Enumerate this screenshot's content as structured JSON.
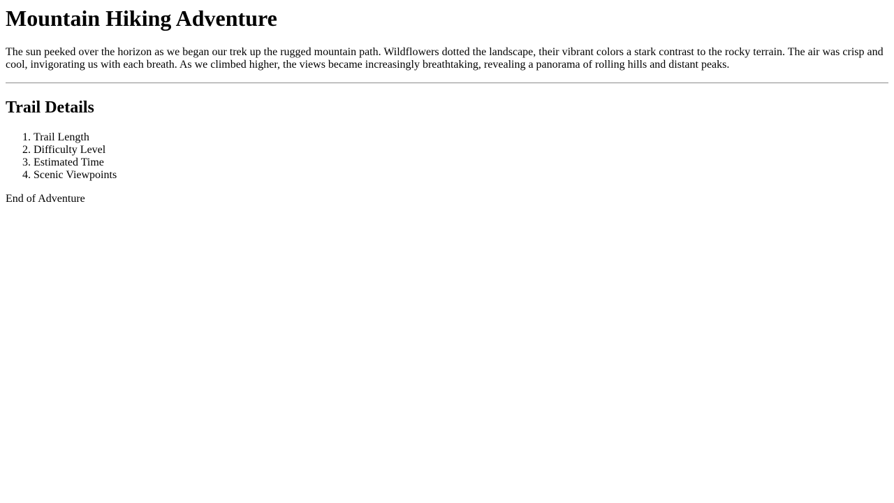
{
  "page": {
    "title": "Mountain Hiking Adventure",
    "intro": "The sun peeked over the horizon as we began our trek up the rugged mountain path. Wildflowers dotted the landscape, their vibrant colors a stark contrast to the rocky terrain. The air was crisp and cool, invigorating us with each breath. As we climbed higher, the views became increasingly breathtaking, revealing a panorama of rolling hills and distant peaks.",
    "section_heading": "Trail Details",
    "trail_items": [
      "Trail Length",
      "Difficulty Level",
      "Estimated Time",
      "Scenic Viewpoints"
    ],
    "footer_text": "End of Adventure"
  }
}
